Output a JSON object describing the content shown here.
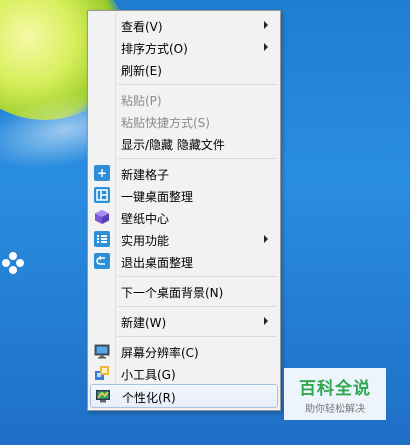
{
  "context_menu": {
    "items": [
      {
        "label": "查看(V)",
        "has_submenu": true,
        "disabled": false,
        "icon": ""
      },
      {
        "label": "排序方式(O)",
        "has_submenu": true,
        "disabled": false,
        "icon": ""
      },
      {
        "label": "刷新(E)",
        "has_submenu": false,
        "disabled": false,
        "icon": ""
      },
      {
        "label": "粘贴(P)",
        "has_submenu": false,
        "disabled": true,
        "icon": ""
      },
      {
        "label": "粘贴快捷方式(S)",
        "has_submenu": false,
        "disabled": true,
        "icon": ""
      },
      {
        "label": "显示/隐藏 隐藏文件",
        "has_submenu": false,
        "disabled": false,
        "icon": ""
      },
      {
        "label": "新建格子",
        "has_submenu": false,
        "disabled": false,
        "icon": "plus-icon"
      },
      {
        "label": "一键桌面整理",
        "has_submenu": false,
        "disabled": false,
        "icon": "layout-icon"
      },
      {
        "label": "壁纸中心",
        "has_submenu": false,
        "disabled": false,
        "icon": "cube-icon"
      },
      {
        "label": "实用功能",
        "has_submenu": true,
        "disabled": false,
        "icon": "list-icon"
      },
      {
        "label": "退出桌面整理",
        "has_submenu": false,
        "disabled": false,
        "icon": "exit-icon"
      },
      {
        "label": "下一个桌面背景(N)",
        "has_submenu": false,
        "disabled": false,
        "icon": ""
      },
      {
        "label": "新建(W)",
        "has_submenu": true,
        "disabled": false,
        "icon": ""
      },
      {
        "label": "屏幕分辨率(C)",
        "has_submenu": false,
        "disabled": false,
        "icon": "monitor-icon"
      },
      {
        "label": "小工具(G)",
        "has_submenu": false,
        "disabled": false,
        "icon": "gadgets-icon"
      },
      {
        "label": "个性化(R)",
        "has_submenu": false,
        "disabled": false,
        "icon": "personalize-icon",
        "highlighted": true
      }
    ]
  },
  "watermark": {
    "title": "百科全说",
    "subtitle": "助你轻松解决"
  },
  "colors": {
    "accent_blue": "#2b8fd9",
    "watermark_green": "#2fa84f",
    "menu_bg": "#f2f2f2"
  }
}
